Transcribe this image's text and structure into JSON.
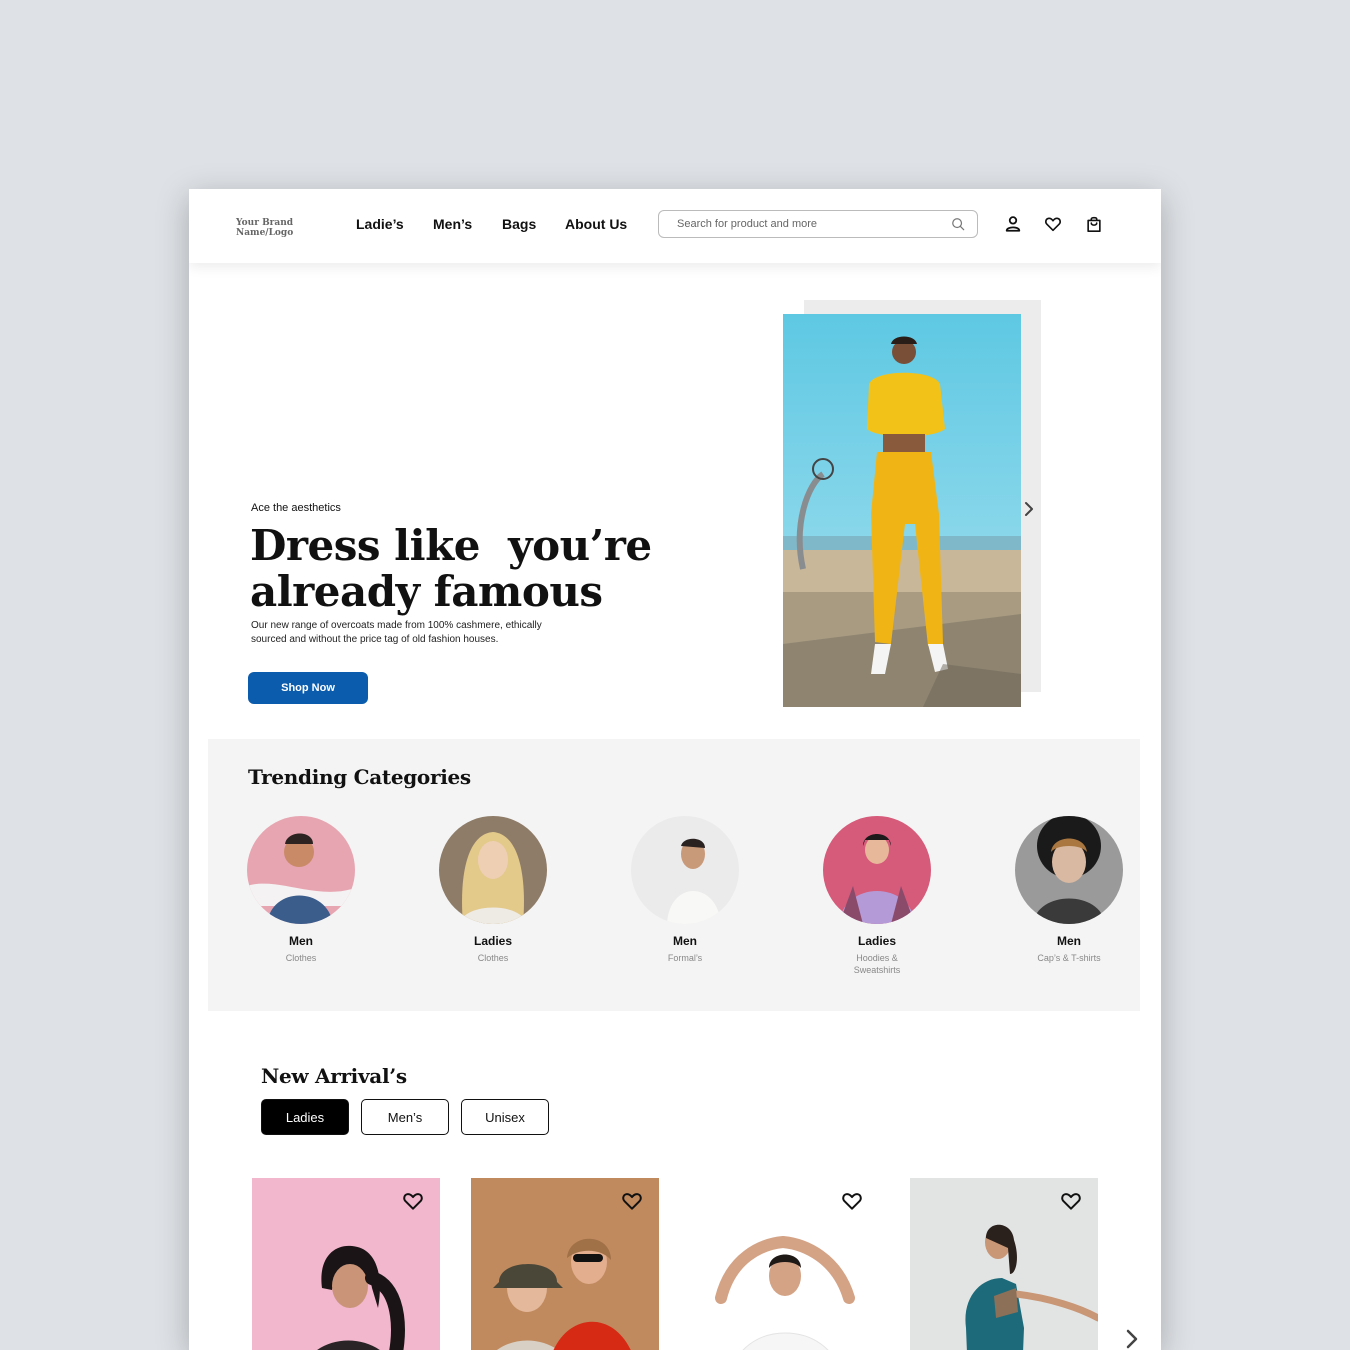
{
  "header": {
    "logo_line1": "Your Brand",
    "logo_line2": "Name/Logo",
    "nav": [
      "Ladie’s",
      "Men’s",
      "Bags",
      "About Us"
    ],
    "search_placeholder": "Search for product and more",
    "icons": [
      "search-icon",
      "user-icon",
      "heart-icon",
      "shopping-bag-icon"
    ]
  },
  "hero": {
    "eyebrow": "Ace the aesthetics",
    "title_line1": "Dress like  you’re",
    "title_line2": "already famous",
    "description": "Our new range of overcoats made from 100% cashmere, ethically sourced and without the price tag of old fashion houses.",
    "cta": "Shop Now"
  },
  "trending": {
    "title": "Trending Categories",
    "categories": [
      {
        "name": "Men",
        "sub": "Clothes"
      },
      {
        "name": "Ladies",
        "sub": "Clothes"
      },
      {
        "name": "Men",
        "sub": "Formal’s"
      },
      {
        "name": "Ladies",
        "sub": "Hoodies & Sweatshirts"
      },
      {
        "name": "Men",
        "sub": "Cap’s & T-shirts"
      }
    ]
  },
  "arrivals": {
    "title": "New Arrival’s",
    "tabs": [
      "Ladies",
      "Men’s",
      "Unisex"
    ],
    "active_tab": "Ladies"
  },
  "colors": {
    "primary": "#0b5cad",
    "background": "#dee2e6",
    "section_bg": "#f4f4f4"
  }
}
